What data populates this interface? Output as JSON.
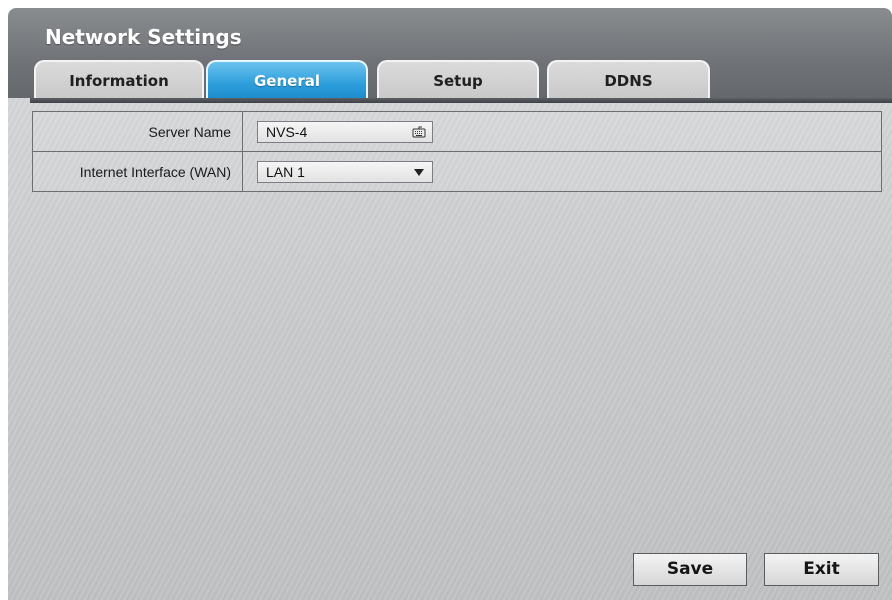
{
  "window": {
    "title": "Network Settings"
  },
  "tabs": [
    {
      "label": "Information",
      "active": false
    },
    {
      "label": "General",
      "active": true
    },
    {
      "label": "Setup",
      "active": false
    },
    {
      "label": "DDNS",
      "active": false
    }
  ],
  "form": {
    "server_name": {
      "label": "Server Name",
      "value": "NVS-4",
      "icon": "keyboard-icon"
    },
    "wan": {
      "label": "Internet Interface (WAN)",
      "value": "LAN 1",
      "icon": "dropdown-arrow-icon"
    }
  },
  "buttons": {
    "save": "Save",
    "exit": "Exit"
  },
  "colors": {
    "active_tab": "#2d9edb",
    "titlebar": "#6f7276"
  }
}
